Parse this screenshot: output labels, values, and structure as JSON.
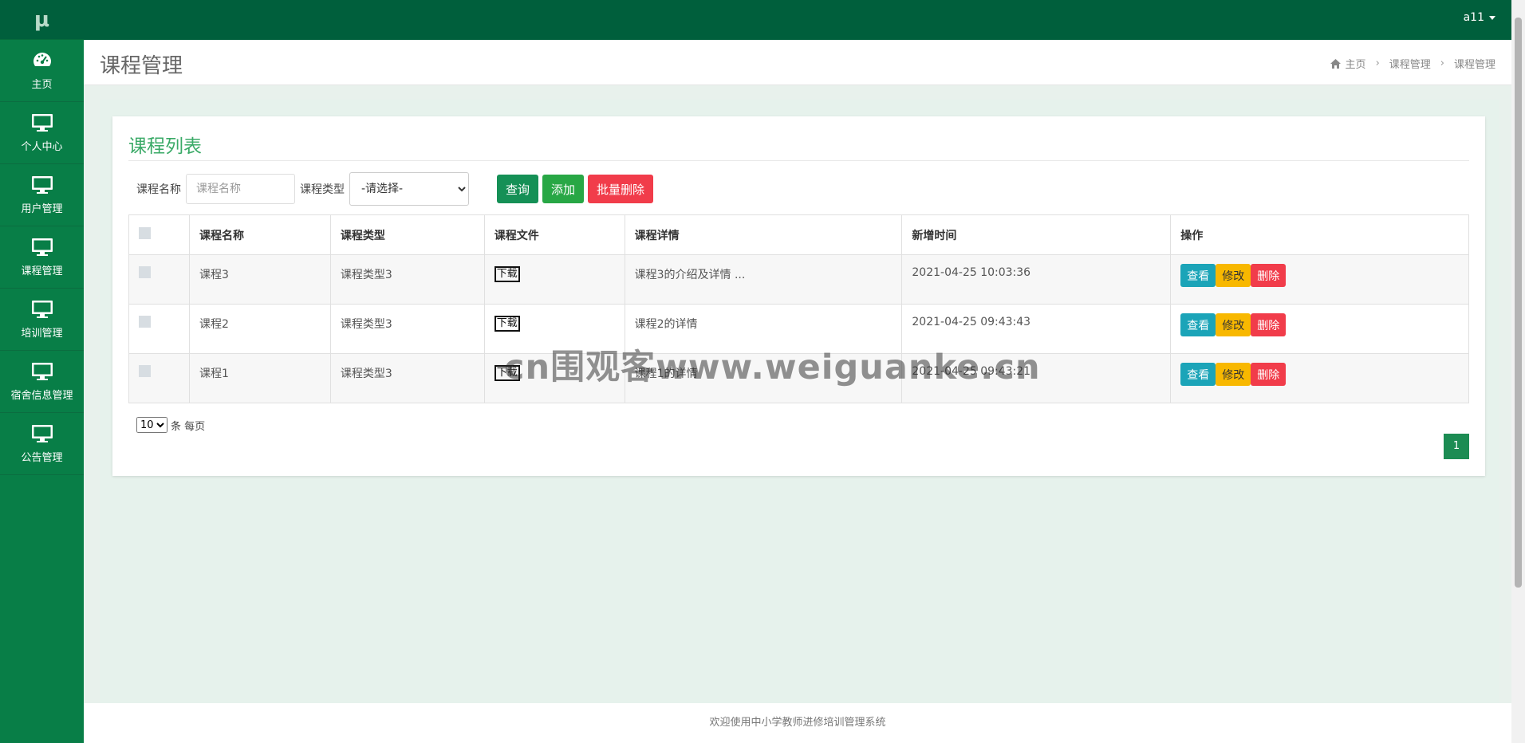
{
  "sidebar": {
    "logo": "μ",
    "items": [
      {
        "label": "主页",
        "icon": "dashboard-icon"
      },
      {
        "label": "个人中心",
        "icon": "monitor-icon"
      },
      {
        "label": "用户管理",
        "icon": "monitor-icon"
      },
      {
        "label": "课程管理",
        "icon": "monitor-icon"
      },
      {
        "label": "培训管理",
        "icon": "monitor-icon"
      },
      {
        "label": "宿舍信息管理",
        "icon": "monitor-icon"
      },
      {
        "label": "公告管理",
        "icon": "monitor-icon"
      }
    ]
  },
  "topbar": {
    "username": "a11"
  },
  "header": {
    "title": "课程管理",
    "breadcrumb": [
      "主页",
      "课程管理",
      "课程管理"
    ]
  },
  "panel": {
    "title": "课程列表",
    "search": {
      "name_label": "课程名称",
      "name_placeholder": "课程名称",
      "type_label": "课程类型",
      "type_selected": "-请选择-"
    },
    "buttons": {
      "query": "查询",
      "add": "添加",
      "batch_delete": "批量删除"
    },
    "table": {
      "columns": [
        "课程名称",
        "课程类型",
        "课程文件",
        "课程详情",
        "新增时间",
        "操作"
      ],
      "rows": [
        {
          "name": "课程3",
          "type": "课程类型3",
          "file": "下载",
          "detail": "课程3的介绍及详情 ...",
          "time": "2021-04-25 10:03:36"
        },
        {
          "name": "课程2",
          "type": "课程类型3",
          "file": "下载",
          "detail": "课程2的详情",
          "time": "2021-04-25 09:43:43"
        },
        {
          "name": "课程1",
          "type": "课程类型3",
          "file": "下载",
          "detail": "课程1的详情",
          "time": "2021-04-25 09:43:21"
        }
      ],
      "actions": {
        "view": "查看",
        "edit": "修改",
        "delete": "删除"
      }
    },
    "pager": {
      "page_size": "10",
      "suffix": "条 每页",
      "current_page": "1"
    }
  },
  "watermark": "cn围观客www.weiguanke.cn",
  "footer": "欢迎使用中小学教师进修培训管理系统",
  "colors": {
    "sidebar": "#087e47",
    "topbar": "#005f3c",
    "accent": "#3aaa67"
  }
}
